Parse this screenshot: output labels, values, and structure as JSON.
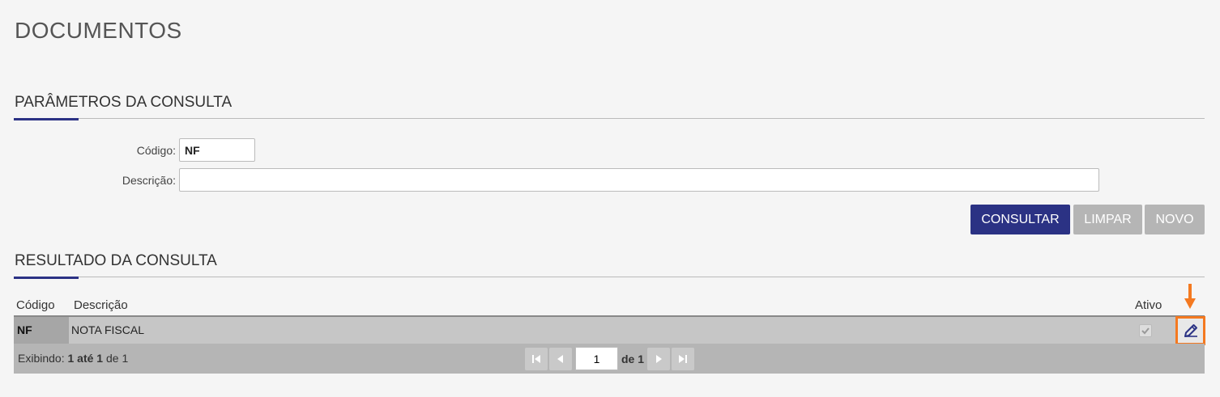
{
  "page": {
    "title": "DOCUMENTOS"
  },
  "params": {
    "title": "PARÂMETROS DA CONSULTA",
    "codigo_label": "Código:",
    "codigo_value": "NF",
    "descricao_label": "Descrição:",
    "descricao_value": ""
  },
  "actions": {
    "consultar": "CONSULTAR",
    "limpar": "LIMPAR",
    "novo": "NOVO"
  },
  "results": {
    "title": "RESULTADO DA CONSULTA",
    "columns": {
      "codigo": "Código",
      "descricao": "Descrição",
      "ativo": "Ativo"
    },
    "rows": [
      {
        "codigo": "NF",
        "descricao": "NOTA FISCAL",
        "ativo": true
      }
    ]
  },
  "pager": {
    "exibindo": "Exibindo:",
    "range": "1 até 1",
    "de": "de",
    "total": "1",
    "current_page": "1",
    "of_pages": "de 1"
  },
  "icons": {
    "edit": "pencil-icon",
    "check": "check-icon",
    "first": "first-page-icon",
    "prev": "prev-page-icon",
    "next": "next-page-icon",
    "last": "last-page-icon",
    "annotation": "arrow-down-icon"
  },
  "colors": {
    "accent": "#2b3284",
    "highlight": "#f47920",
    "secondary_button": "#b5b5b5"
  }
}
